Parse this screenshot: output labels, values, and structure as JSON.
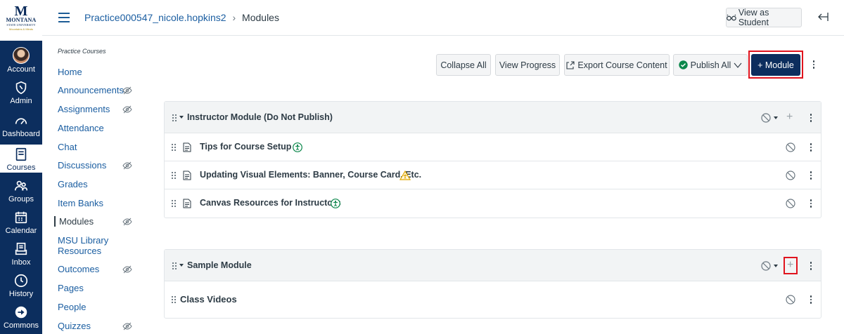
{
  "global_nav": {
    "logo": {
      "mark": "M",
      "name": "MONTANA",
      "sub": "STATE UNIVERSITY",
      "tagline": "Mountains & Minds"
    },
    "items": [
      {
        "label": "Account",
        "icon": "avatar-icon"
      },
      {
        "label": "Admin",
        "icon": "shield-icon"
      },
      {
        "label": "Dashboard",
        "icon": "dashboard-icon"
      },
      {
        "label": "Courses",
        "icon": "book-icon"
      },
      {
        "label": "Groups",
        "icon": "groups-icon"
      },
      {
        "label": "Calendar",
        "icon": "calendar-icon"
      },
      {
        "label": "Inbox",
        "icon": "inbox-icon"
      },
      {
        "label": "History",
        "icon": "clock-icon"
      },
      {
        "label": "Commons",
        "icon": "commons-icon"
      }
    ]
  },
  "header": {
    "breadcrumb": {
      "course": "Practice000547_nicole.hopkins2",
      "separator": "›",
      "current": "Modules"
    },
    "view_as_student": "View as Student"
  },
  "course_nav": {
    "title": "Practice Courses",
    "items": [
      {
        "label": "Home",
        "hidden": false
      },
      {
        "label": "Announcements",
        "hidden": true
      },
      {
        "label": "Assignments",
        "hidden": true
      },
      {
        "label": "Attendance",
        "hidden": false
      },
      {
        "label": "Chat",
        "hidden": false
      },
      {
        "label": "Discussions",
        "hidden": true
      },
      {
        "label": "Grades",
        "hidden": false
      },
      {
        "label": "Item Banks",
        "hidden": false
      },
      {
        "label": "Modules",
        "hidden": true,
        "active": true
      },
      {
        "label": "MSU Library Resources",
        "hidden": false
      },
      {
        "label": "Outcomes",
        "hidden": true
      },
      {
        "label": "Pages",
        "hidden": false
      },
      {
        "label": "People",
        "hidden": false
      },
      {
        "label": "Quizzes",
        "hidden": true
      }
    ]
  },
  "toolbar": {
    "collapse_all": "Collapse All",
    "view_progress": "View Progress",
    "export": "Export Course Content",
    "publish_all": "Publish All",
    "add_module": "+ Module"
  },
  "modules": [
    {
      "title": "Instructor Module (Do Not Publish)",
      "items": [
        {
          "title": "Tips for Course Setup",
          "badge": "accessibility-ok"
        },
        {
          "title": "Updating Visual Elements: Banner, Course Card, Etc.",
          "badge": "accessibility-warning"
        },
        {
          "title": "Canvas Resources for Instructors",
          "badge": "accessibility-ok"
        }
      ]
    },
    {
      "title": "Sample Module",
      "items": [
        {
          "title": "Class Videos",
          "badge": ""
        }
      ]
    }
  ],
  "colors": {
    "nav_bg": "#0c2e5e",
    "link": "#1b5ea1",
    "highlight": "#e0141e",
    "publish_green": "#0b874b",
    "warning": "#e0a800",
    "access_green": "#0b874b"
  }
}
